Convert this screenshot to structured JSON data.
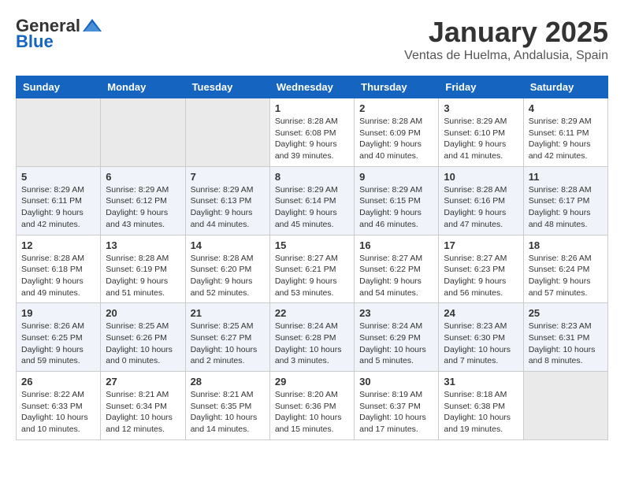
{
  "logo": {
    "general": "General",
    "blue": "Blue"
  },
  "title": "January 2025",
  "location": "Ventas de Huelma, Andalusia, Spain",
  "days_of_week": [
    "Sunday",
    "Monday",
    "Tuesday",
    "Wednesday",
    "Thursday",
    "Friday",
    "Saturday"
  ],
  "weeks": [
    [
      {
        "num": "",
        "empty": true
      },
      {
        "num": "",
        "empty": true
      },
      {
        "num": "",
        "empty": true
      },
      {
        "num": "1",
        "sunrise": "8:28 AM",
        "sunset": "6:08 PM",
        "daylight": "9 hours and 39 minutes."
      },
      {
        "num": "2",
        "sunrise": "8:28 AM",
        "sunset": "6:09 PM",
        "daylight": "9 hours and 40 minutes."
      },
      {
        "num": "3",
        "sunrise": "8:29 AM",
        "sunset": "6:10 PM",
        "daylight": "9 hours and 41 minutes."
      },
      {
        "num": "4",
        "sunrise": "8:29 AM",
        "sunset": "6:11 PM",
        "daylight": "9 hours and 42 minutes."
      }
    ],
    [
      {
        "num": "5",
        "sunrise": "8:29 AM",
        "sunset": "6:11 PM",
        "daylight": "9 hours and 42 minutes."
      },
      {
        "num": "6",
        "sunrise": "8:29 AM",
        "sunset": "6:12 PM",
        "daylight": "9 hours and 43 minutes."
      },
      {
        "num": "7",
        "sunrise": "8:29 AM",
        "sunset": "6:13 PM",
        "daylight": "9 hours and 44 minutes."
      },
      {
        "num": "8",
        "sunrise": "8:29 AM",
        "sunset": "6:14 PM",
        "daylight": "9 hours and 45 minutes."
      },
      {
        "num": "9",
        "sunrise": "8:29 AM",
        "sunset": "6:15 PM",
        "daylight": "9 hours and 46 minutes."
      },
      {
        "num": "10",
        "sunrise": "8:28 AM",
        "sunset": "6:16 PM",
        "daylight": "9 hours and 47 minutes."
      },
      {
        "num": "11",
        "sunrise": "8:28 AM",
        "sunset": "6:17 PM",
        "daylight": "9 hours and 48 minutes."
      }
    ],
    [
      {
        "num": "12",
        "sunrise": "8:28 AM",
        "sunset": "6:18 PM",
        "daylight": "9 hours and 49 minutes."
      },
      {
        "num": "13",
        "sunrise": "8:28 AM",
        "sunset": "6:19 PM",
        "daylight": "9 hours and 51 minutes."
      },
      {
        "num": "14",
        "sunrise": "8:28 AM",
        "sunset": "6:20 PM",
        "daylight": "9 hours and 52 minutes."
      },
      {
        "num": "15",
        "sunrise": "8:27 AM",
        "sunset": "6:21 PM",
        "daylight": "9 hours and 53 minutes."
      },
      {
        "num": "16",
        "sunrise": "8:27 AM",
        "sunset": "6:22 PM",
        "daylight": "9 hours and 54 minutes."
      },
      {
        "num": "17",
        "sunrise": "8:27 AM",
        "sunset": "6:23 PM",
        "daylight": "9 hours and 56 minutes."
      },
      {
        "num": "18",
        "sunrise": "8:26 AM",
        "sunset": "6:24 PM",
        "daylight": "9 hours and 57 minutes."
      }
    ],
    [
      {
        "num": "19",
        "sunrise": "8:26 AM",
        "sunset": "6:25 PM",
        "daylight": "9 hours and 59 minutes."
      },
      {
        "num": "20",
        "sunrise": "8:25 AM",
        "sunset": "6:26 PM",
        "daylight": "10 hours and 0 minutes."
      },
      {
        "num": "21",
        "sunrise": "8:25 AM",
        "sunset": "6:27 PM",
        "daylight": "10 hours and 2 minutes."
      },
      {
        "num": "22",
        "sunrise": "8:24 AM",
        "sunset": "6:28 PM",
        "daylight": "10 hours and 3 minutes."
      },
      {
        "num": "23",
        "sunrise": "8:24 AM",
        "sunset": "6:29 PM",
        "daylight": "10 hours and 5 minutes."
      },
      {
        "num": "24",
        "sunrise": "8:23 AM",
        "sunset": "6:30 PM",
        "daylight": "10 hours and 7 minutes."
      },
      {
        "num": "25",
        "sunrise": "8:23 AM",
        "sunset": "6:31 PM",
        "daylight": "10 hours and 8 minutes."
      }
    ],
    [
      {
        "num": "26",
        "sunrise": "8:22 AM",
        "sunset": "6:33 PM",
        "daylight": "10 hours and 10 minutes."
      },
      {
        "num": "27",
        "sunrise": "8:21 AM",
        "sunset": "6:34 PM",
        "daylight": "10 hours and 12 minutes."
      },
      {
        "num": "28",
        "sunrise": "8:21 AM",
        "sunset": "6:35 PM",
        "daylight": "10 hours and 14 minutes."
      },
      {
        "num": "29",
        "sunrise": "8:20 AM",
        "sunset": "6:36 PM",
        "daylight": "10 hours and 15 minutes."
      },
      {
        "num": "30",
        "sunrise": "8:19 AM",
        "sunset": "6:37 PM",
        "daylight": "10 hours and 17 minutes."
      },
      {
        "num": "31",
        "sunrise": "8:18 AM",
        "sunset": "6:38 PM",
        "daylight": "10 hours and 19 minutes."
      },
      {
        "num": "",
        "empty": true
      }
    ]
  ]
}
